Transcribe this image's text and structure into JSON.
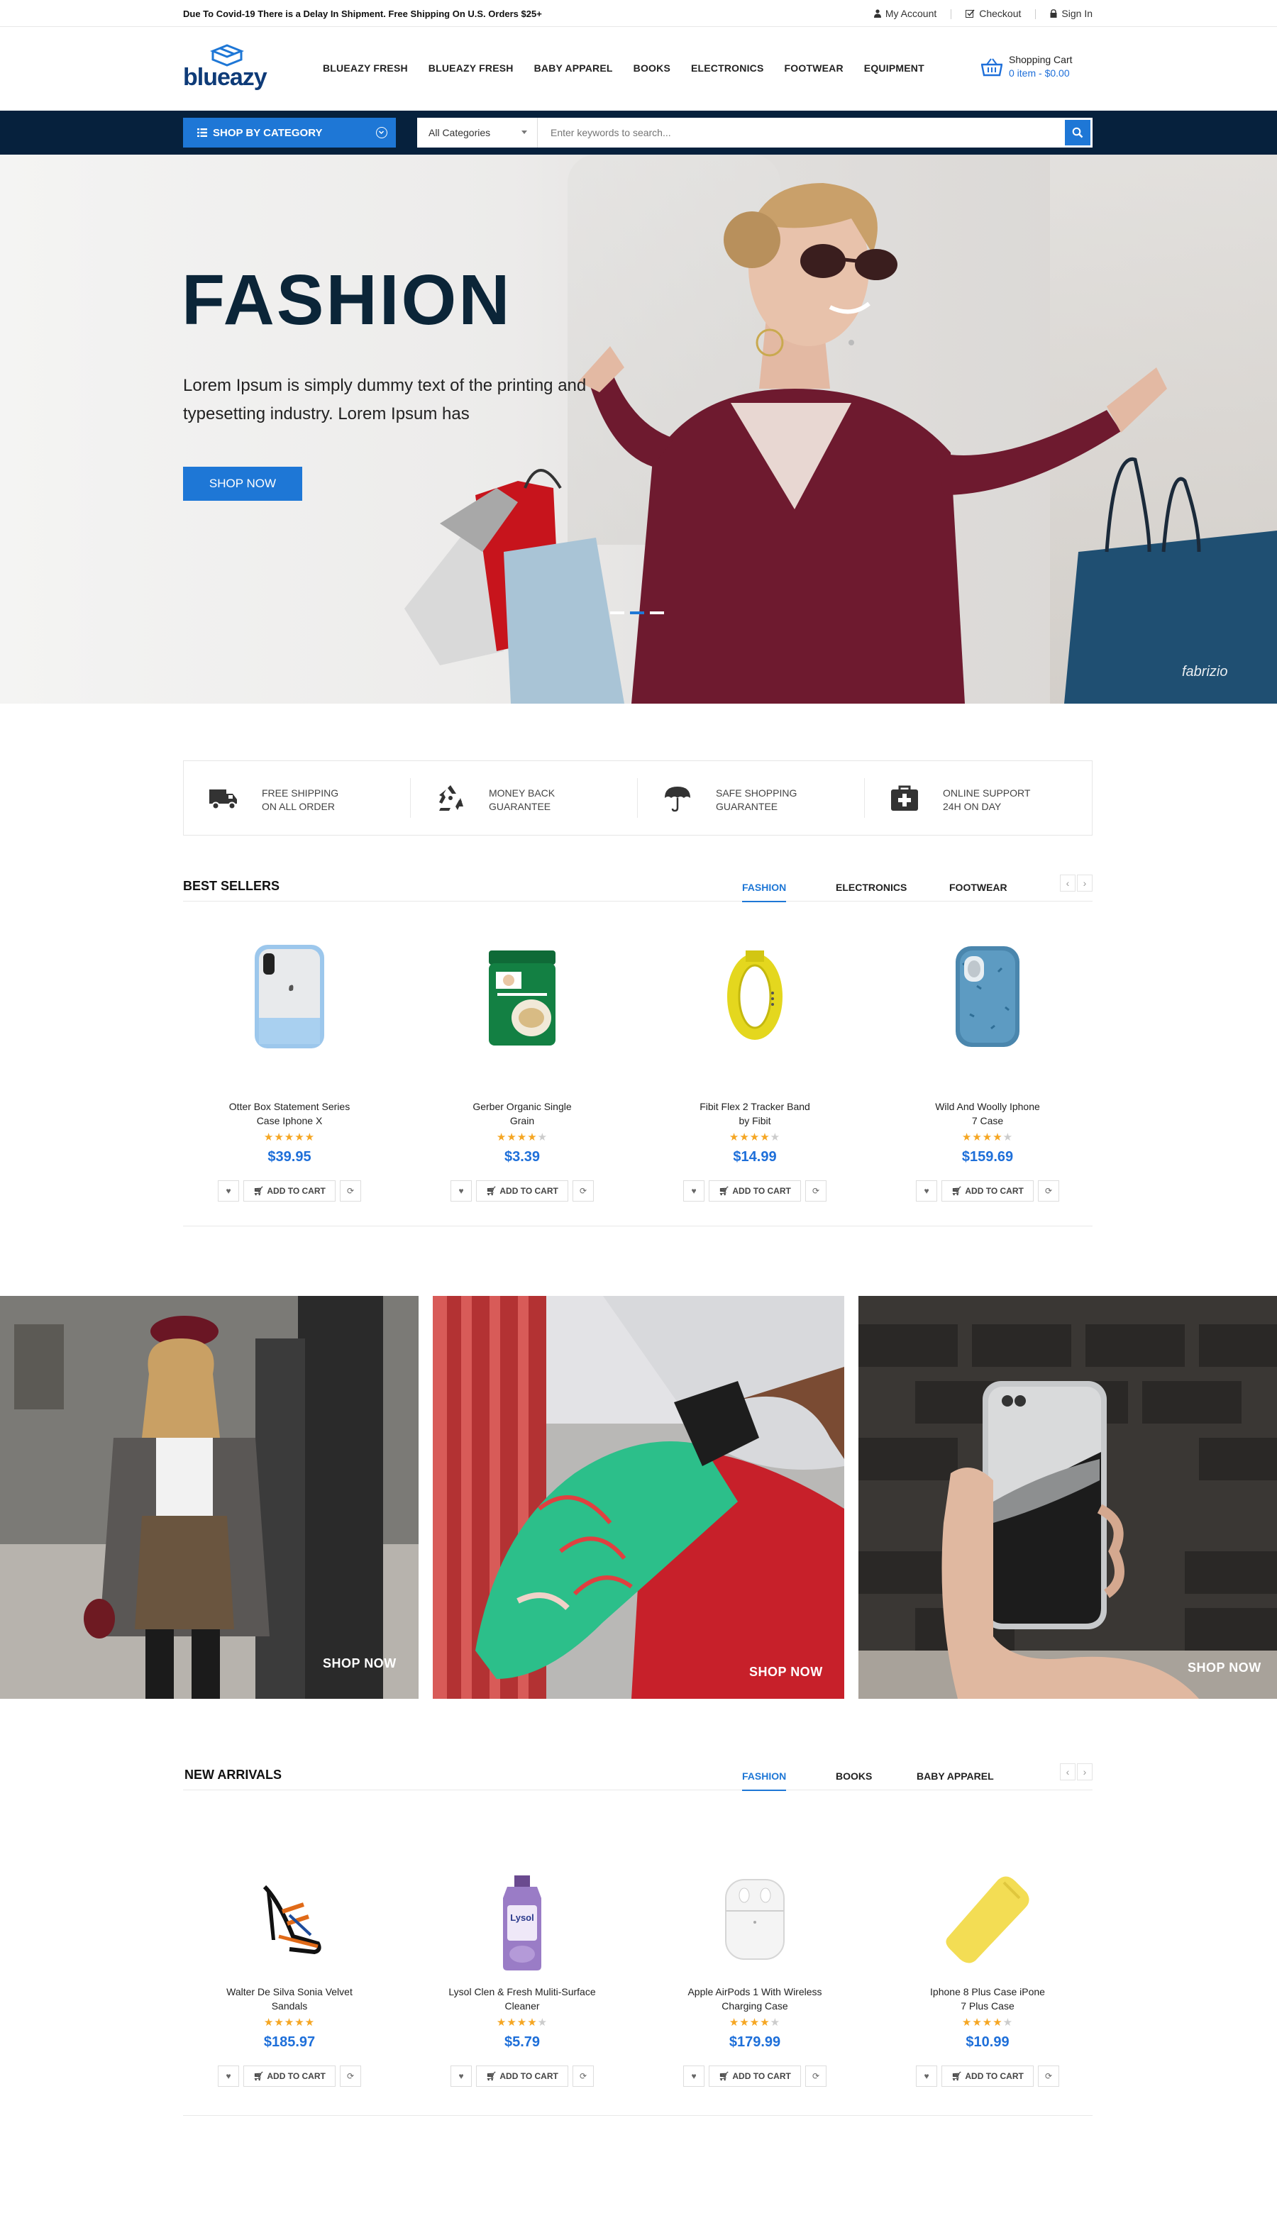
{
  "topbar": {
    "notice": "Due To Covid-19 There is a Delay In Shipment. Free Shipping On U.S. Orders $25+",
    "links": [
      "My Account",
      "Checkout",
      "Sign In"
    ]
  },
  "header": {
    "logo": "blueazy",
    "nav": [
      "BLUEAZY FRESH",
      "BLUEAZY FRESH",
      "BABY APPAREL",
      "BOOKS",
      "ELECTRONICS",
      "FOOTWEAR",
      "EQUIPMENT"
    ],
    "cart": {
      "title": "Shopping Cart",
      "summary": "0 item - $0.00"
    }
  },
  "searchbar": {
    "category_button": "SHOP BY CATEGORY",
    "category_select": "All Categories",
    "placeholder": "Enter keywords to search..."
  },
  "hero": {
    "title": "FASHION",
    "text": "Lorem Ipsum is simply dummy text of the printing and typesetting industry. Lorem Ipsum has",
    "button": "SHOP NOW",
    "credit": "fabrizio",
    "slides": 3,
    "active_slide": 2
  },
  "features": [
    {
      "icon": "truck-icon",
      "line1": "FREE SHIPPING",
      "line2": "ON ALL ORDER"
    },
    {
      "icon": "recycle-icon",
      "line1": "MONEY BACK",
      "line2": "GUARANTEE"
    },
    {
      "icon": "umbrella-icon",
      "line1": "SAFE SHOPPING",
      "line2": "GUARANTEE"
    },
    {
      "icon": "briefcase-medical-icon",
      "line1": "ONLINE SUPPORT",
      "line2": "24H ON DAY"
    }
  ],
  "best_sellers": {
    "title": "BEST SELLERS",
    "tabs": [
      "FASHION",
      "ELECTRONICS",
      "FOOTWEAR"
    ],
    "active_tab": "FASHION",
    "products": [
      {
        "name1": "Otter Box Statement Series",
        "name2": "Case Iphone X",
        "rating": 5,
        "price": "$39.95",
        "thumb": "phone-case-blue"
      },
      {
        "name1": "Gerber Organic Single",
        "name2": "Grain",
        "rating": 4,
        "price": "$3.39",
        "thumb": "oatmeal-canister"
      },
      {
        "name1": "Fibit Flex 2 Tracker Band",
        "name2": "by Fibit",
        "rating": 4,
        "price": "$14.99",
        "thumb": "yellow-band"
      },
      {
        "name1": "Wild And Woolly Iphone",
        "name2": "7 Case",
        "rating": 4,
        "price": "$159.69",
        "thumb": "fur-case"
      }
    ]
  },
  "card_actions": {
    "add_to_cart": "ADD TO CART"
  },
  "banners": [
    {
      "label": "SHOP NOW"
    },
    {
      "label": "SHOP NOW"
    },
    {
      "label": "SHOP NOW"
    }
  ],
  "new_arrivals": {
    "title": "NEW ARRIVALS",
    "tabs": [
      "FASHION",
      "BOOKS",
      "BABY APPAREL"
    ],
    "active_tab": "FASHION",
    "products": [
      {
        "name1": "Walter De Silva Sonia Velvet",
        "name2": "Sandals",
        "rating": 5,
        "price": "$185.97",
        "thumb": "heel-sandal"
      },
      {
        "name1": "Lysol Clen & Fresh Muliti-Surface",
        "name2": "Cleaner",
        "rating": 4,
        "price": "$5.79",
        "thumb": "cleaner-bottle"
      },
      {
        "name1": "Apple AirPods 1 With Wireless",
        "name2": "Charging Case",
        "rating": 4,
        "price": "$179.99",
        "thumb": "airpods-case"
      },
      {
        "name1": "Iphone 8 Plus Case iPone",
        "name2": "7 Plus Case",
        "rating": 4,
        "price": "$10.99",
        "thumb": "yellow-case"
      }
    ]
  },
  "colors": {
    "accent": "#1e77d6",
    "navy": "#06213d",
    "price": "#1e6fd9",
    "star": "#f5a623"
  }
}
